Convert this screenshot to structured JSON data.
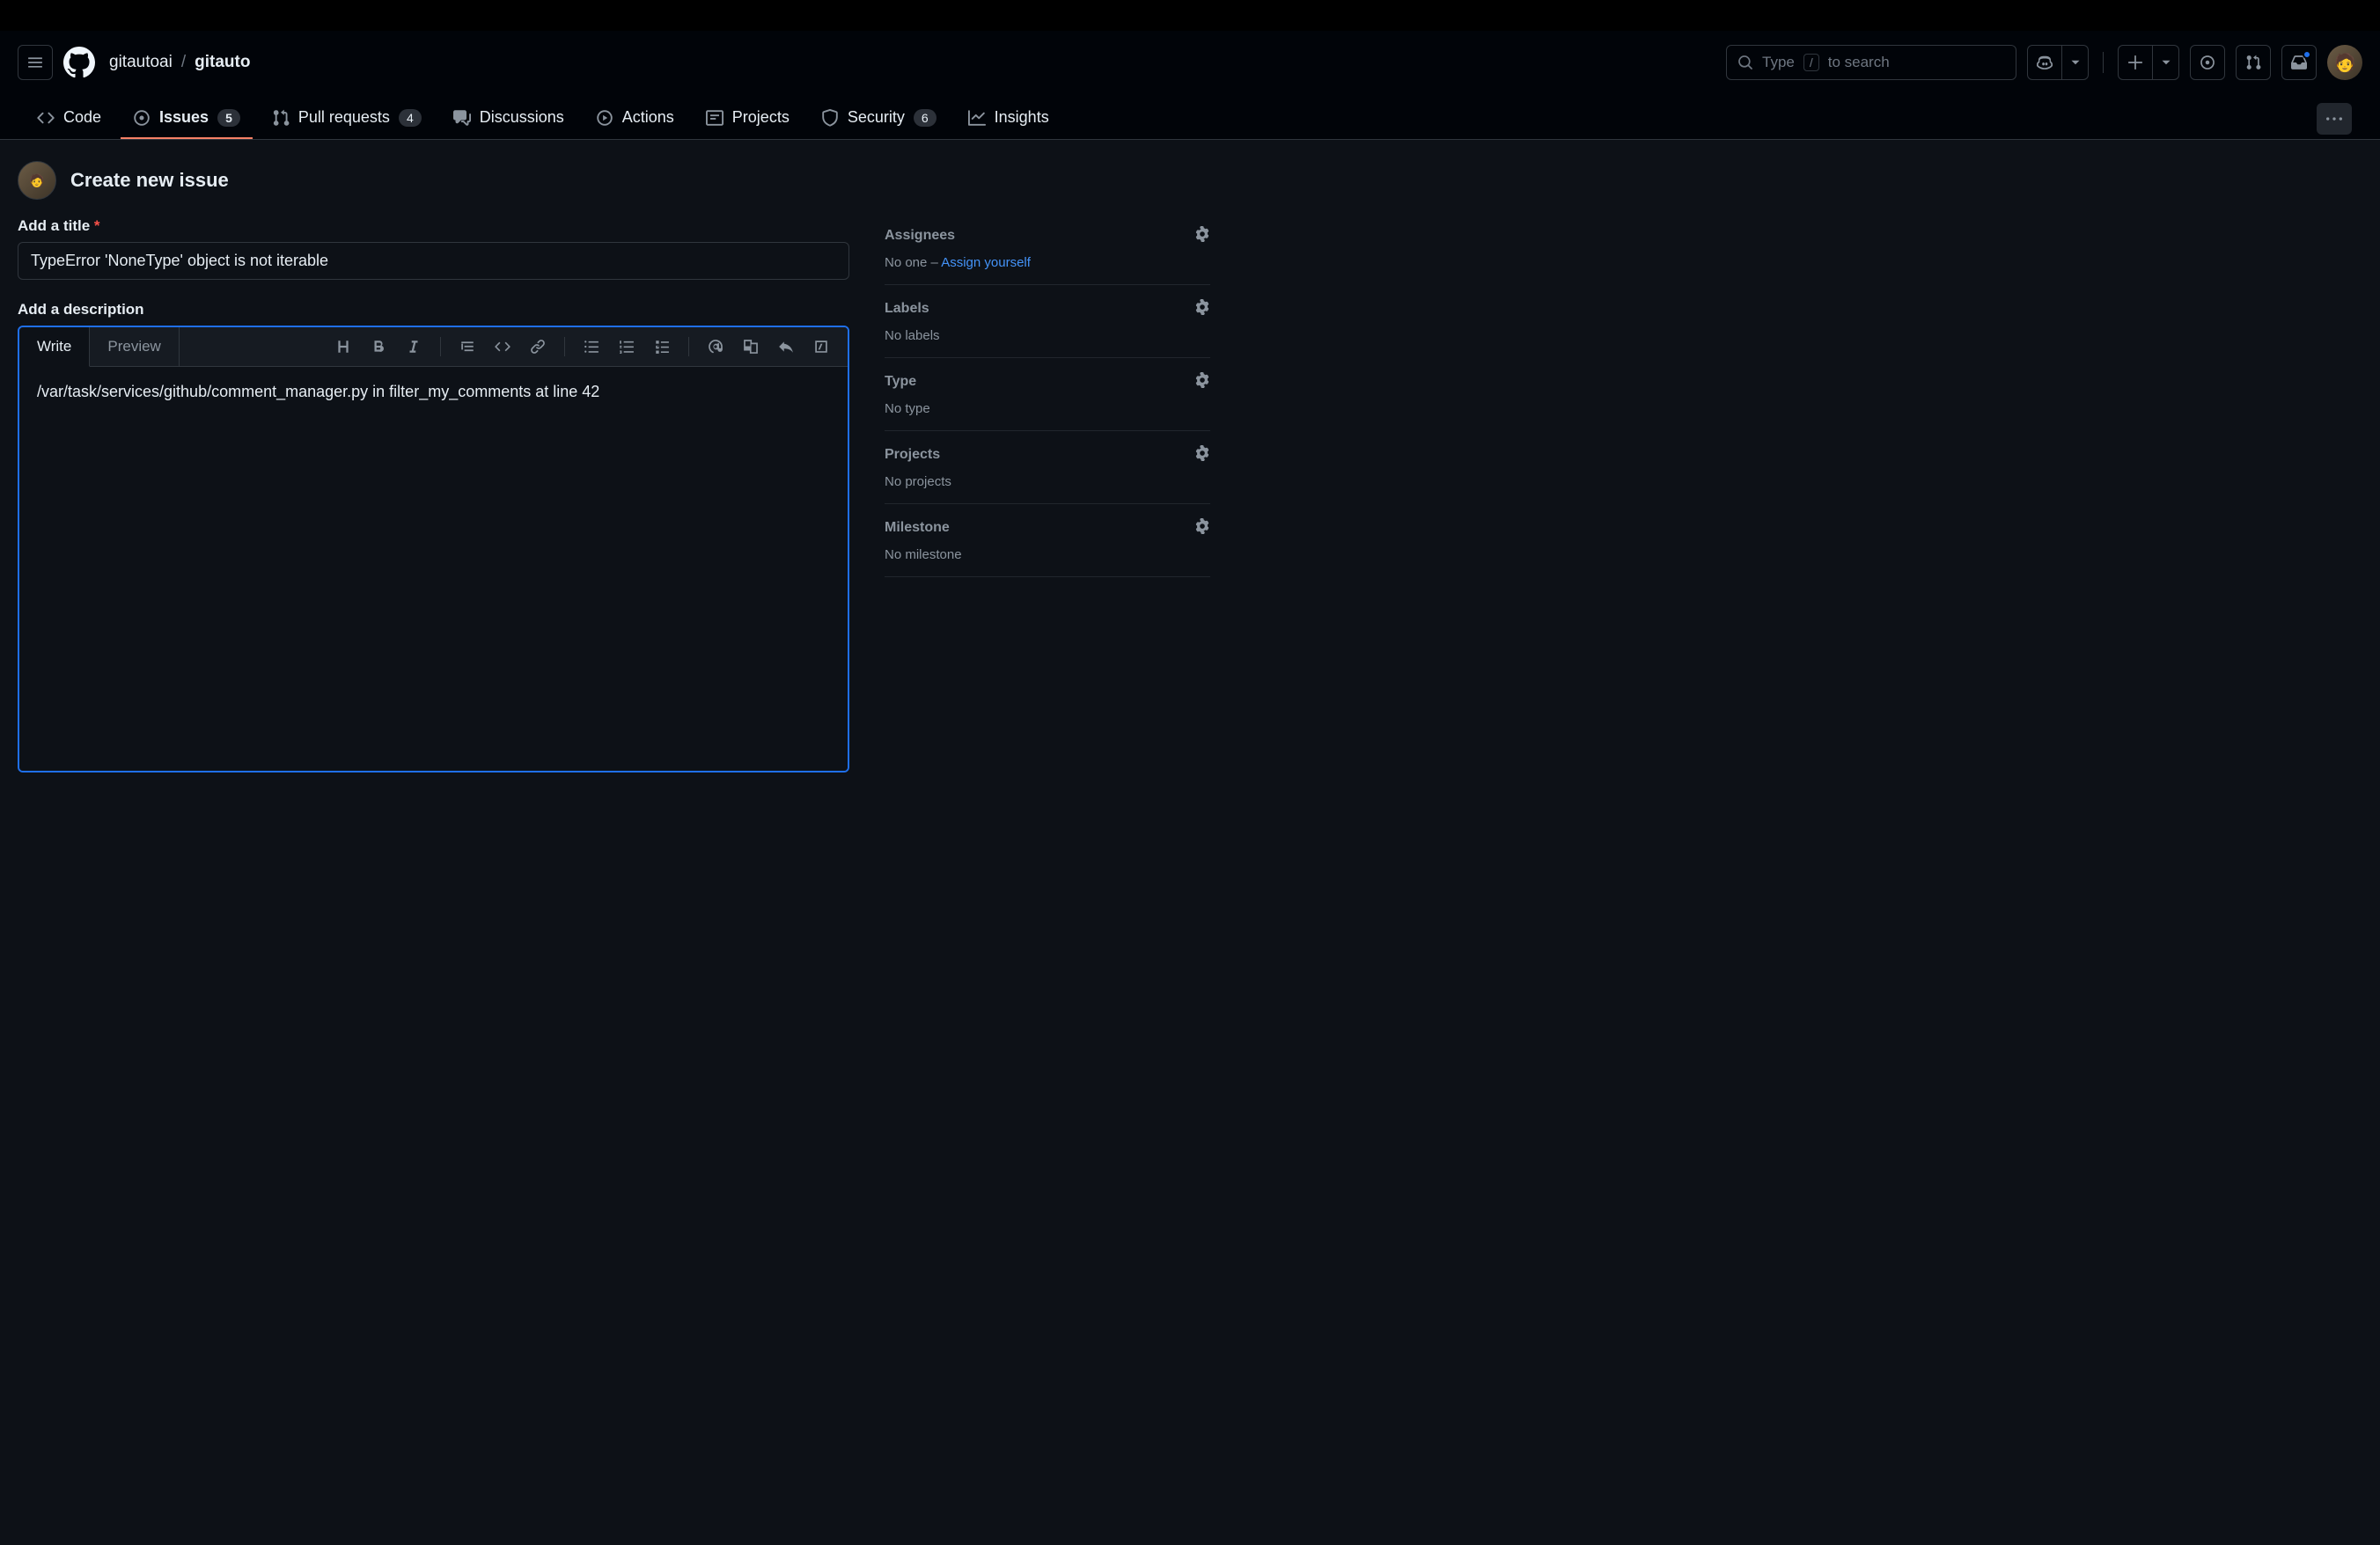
{
  "breadcrumb": {
    "owner": "gitautoai",
    "repo": "gitauto"
  },
  "search": {
    "prefix": "Type",
    "slash": "/",
    "suffix": "to search"
  },
  "tabs": {
    "code": "Code",
    "issues": {
      "label": "Issues",
      "count": "5"
    },
    "pulls": {
      "label": "Pull requests",
      "count": "4"
    },
    "discussions": "Discussions",
    "actions": "Actions",
    "projects": "Projects",
    "security": {
      "label": "Security",
      "count": "6"
    },
    "insights": "Insights"
  },
  "page": {
    "title": "Create new issue",
    "title_label": "Add a title",
    "title_value": "TypeError 'NoneType' object is not iterable",
    "desc_label": "Add a description",
    "desc_value": "/var/task/services/github/comment_manager.py in filter_my_comments at line 42"
  },
  "editor": {
    "write": "Write",
    "preview": "Preview"
  },
  "sidebar": {
    "assignees": {
      "title": "Assignees",
      "prefix": "No one – ",
      "link": "Assign yourself"
    },
    "labels": {
      "title": "Labels",
      "body": "No labels"
    },
    "type": {
      "title": "Type",
      "body": "No type"
    },
    "projects": {
      "title": "Projects",
      "body": "No projects"
    },
    "milestone": {
      "title": "Milestone",
      "body": "No milestone"
    }
  }
}
